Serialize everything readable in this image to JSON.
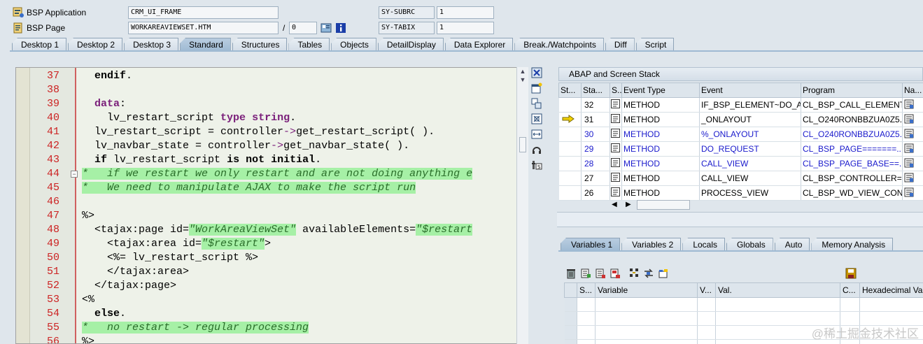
{
  "header": {
    "app_label": "BSP Application",
    "app_value": "CRM_UI_FRAME",
    "page_label": "BSP Page",
    "page_value": "WORKAREAVIEWSET.HTM",
    "page_sep": "/",
    "page_num": "0",
    "sys1_name": "SY-SUBRC",
    "sys1_value": "1",
    "sys2_name": "SY-TABIX",
    "sys2_value": "1"
  },
  "tabs": [
    "Desktop 1",
    "Desktop 2",
    "Desktop 3",
    "Standard",
    "Structures",
    "Tables",
    "Objects",
    "DetailDisplay",
    "Data Explorer",
    "Break./Watchpoints",
    "Diff",
    "Script"
  ],
  "active_tab": "Standard",
  "code": [
    {
      "n": "37",
      "text": "  endif."
    },
    {
      "n": "38",
      "text": ""
    },
    {
      "n": "39",
      "text": "  data:"
    },
    {
      "n": "40",
      "text": "    lv_restart_script type string."
    },
    {
      "n": "41",
      "text": "  lv_restart_script = controller->get_restart_script( )."
    },
    {
      "n": "42",
      "text": "  lv_navbar_state = controller->get_navbar_state( )."
    },
    {
      "n": "43",
      "text": "  if lv_restart_script is not initial."
    },
    {
      "n": "44",
      "text": "*   if we restart we only restart and are not doing anything e"
    },
    {
      "n": "45",
      "text": "*   We need to manipulate AJAX to make the script run"
    },
    {
      "n": "46",
      "text": ""
    },
    {
      "n": "47",
      "text": "%>"
    },
    {
      "n": "48",
      "text": "  <tajax:page id=\"WorkAreaViewSet\" availableElements=\"$restart"
    },
    {
      "n": "49",
      "text": "    <tajax:area id=\"$restart\">"
    },
    {
      "n": "50",
      "text": "    <%= lv_restart_script %>"
    },
    {
      "n": "51",
      "text": "    </tajax:area>"
    },
    {
      "n": "52",
      "text": "  </tajax:page>"
    },
    {
      "n": "53",
      "text": "<%"
    },
    {
      "n": "54",
      "text": "  else."
    },
    {
      "n": "55",
      "text": "*   no restart -> regular processing"
    },
    {
      "n": "56",
      "text": "%>"
    }
  ],
  "stack": {
    "title": "ABAP and Screen Stack",
    "columns": [
      "St...",
      "Sta...",
      "S...",
      "Event Type",
      "Event",
      "Program",
      "Na..."
    ],
    "rows": [
      {
        "level": "32",
        "type": "METHOD",
        "event": "IF_BSP_ELEMENT~DO_A...",
        "program": "CL_BSP_CALL_ELEMENT...",
        "current": false,
        "hl": false
      },
      {
        "level": "31",
        "type": "METHOD",
        "event": "_ONLAYOUT",
        "program": "CL_O240RONBBZUA0Z5...",
        "current": true,
        "hl": false
      },
      {
        "level": "30",
        "type": "METHOD",
        "event": "%_ONLAYOUT",
        "program": "CL_O240RONBBZUA0Z5...",
        "current": false,
        "hl": true
      },
      {
        "level": "29",
        "type": "METHOD",
        "event": "DO_REQUEST",
        "program": "CL_BSP_PAGE=======...",
        "current": false,
        "hl": true
      },
      {
        "level": "28",
        "type": "METHOD",
        "event": "CALL_VIEW",
        "program": "CL_BSP_PAGE_BASE==...",
        "current": false,
        "hl": true
      },
      {
        "level": "27",
        "type": "METHOD",
        "event": "CALL_VIEW",
        "program": "CL_BSP_CONTROLLER=...",
        "current": false,
        "hl": false
      },
      {
        "level": "26",
        "type": "METHOD",
        "event": "PROCESS_VIEW",
        "program": "CL_BSP_WD_VIEW_CON...",
        "current": false,
        "hl": false
      }
    ]
  },
  "var_tabs": [
    "Variables 1",
    "Variables 2",
    "Locals",
    "Globals",
    "Auto",
    "Memory Analysis"
  ],
  "active_var_tab": "Variables 1",
  "var_columns": [
    "S...",
    "Variable",
    "V...",
    "Val.",
    "C...",
    "Hexadecimal Value"
  ],
  "watermark": "@稀土掘金技术社区",
  "colors": {
    "accent": "#9fbad3",
    "linenum": "#cc2222",
    "comment_bg": "#a6f0a6"
  }
}
